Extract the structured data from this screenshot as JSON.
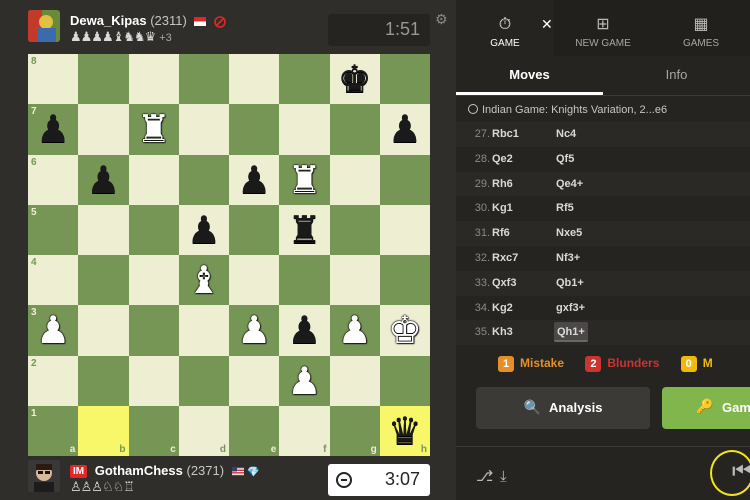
{
  "top_player": {
    "name": "Dewa_Kipas",
    "rating": "(2311)",
    "captured": "♟♟♟♟♝♞♞♛",
    "advantage": "+3",
    "clock": "1:51"
  },
  "bottom_player": {
    "title": "IM",
    "name": "GothamChess",
    "rating": "(2371)",
    "captured": "♙♙♙♘♘♖",
    "clock": "3:07",
    "diamond": "💎"
  },
  "board": {
    "ranks": [
      "8",
      "7",
      "6",
      "5",
      "4",
      "3",
      "2",
      "1"
    ],
    "files": [
      "a",
      "b",
      "c",
      "d",
      "e",
      "f",
      "g",
      "h"
    ],
    "position": [
      [
        "",
        "",
        "",
        "",
        "",
        "",
        "bk",
        ""
      ],
      [
        "bp",
        "",
        "wr",
        "",
        "",
        "",
        "",
        "bp"
      ],
      [
        "",
        "bp",
        "",
        "",
        "bp",
        "wr",
        "",
        ""
      ],
      [
        "",
        "",
        "",
        "bp",
        "",
        "br",
        "",
        ""
      ],
      [
        "",
        "",
        "",
        "wb",
        "",
        "",
        "",
        ""
      ],
      [
        "wp",
        "",
        "",
        "",
        "wp",
        "bp",
        "wp",
        "wk"
      ],
      [
        "",
        "",
        "",
        "",
        "",
        "wp",
        "",
        ""
      ],
      [
        "",
        "",
        "",
        "",
        "",
        "",
        "",
        "bq"
      ]
    ],
    "highlights": [
      "b1",
      "h1"
    ]
  },
  "tabs": [
    {
      "label": "GAME",
      "icon": "stopwatch-icon",
      "glyph": "⏱"
    },
    {
      "label": "NEW GAME",
      "icon": "plus-square-icon",
      "glyph": "⊞"
    },
    {
      "label": "GAMES",
      "icon": "board-icon",
      "glyph": "▦"
    }
  ],
  "subtabs": [
    "Moves",
    "Info"
  ],
  "opening": "Indian Game: Knights Variation, 2...e6",
  "moves": [
    {
      "n": "27.",
      "w": "Rbc1",
      "b": "Nc4"
    },
    {
      "n": "28.",
      "w": "Qe2",
      "b": "Qf5"
    },
    {
      "n": "29.",
      "w": "Rh6",
      "b": "Qe4+"
    },
    {
      "n": "30.",
      "w": "Kg1",
      "b": "Rf5"
    },
    {
      "n": "31.",
      "w": "Rf6",
      "b": "Nxe5"
    },
    {
      "n": "32.",
      "w": "Rxc7",
      "b": "Nf3+"
    },
    {
      "n": "33.",
      "w": "Qxf3",
      "b": "Qb1+"
    },
    {
      "n": "34.",
      "w": "Kg2",
      "b": "gxf3+"
    },
    {
      "n": "35.",
      "w": "Kh3",
      "b": "Qh1+"
    }
  ],
  "stats": [
    {
      "count": "1",
      "label": "Mistake",
      "color": "#e58f2a"
    },
    {
      "count": "2",
      "label": "Blunders",
      "color": "#ca3431"
    },
    {
      "count": "0",
      "label": "M",
      "color": "#f0b90b"
    }
  ],
  "buttons": {
    "analysis": "Analysis",
    "game": "Game"
  },
  "colors": {
    "light_square": "#eeeed2",
    "dark_square": "#769656",
    "accent_green": "#81b64c"
  }
}
